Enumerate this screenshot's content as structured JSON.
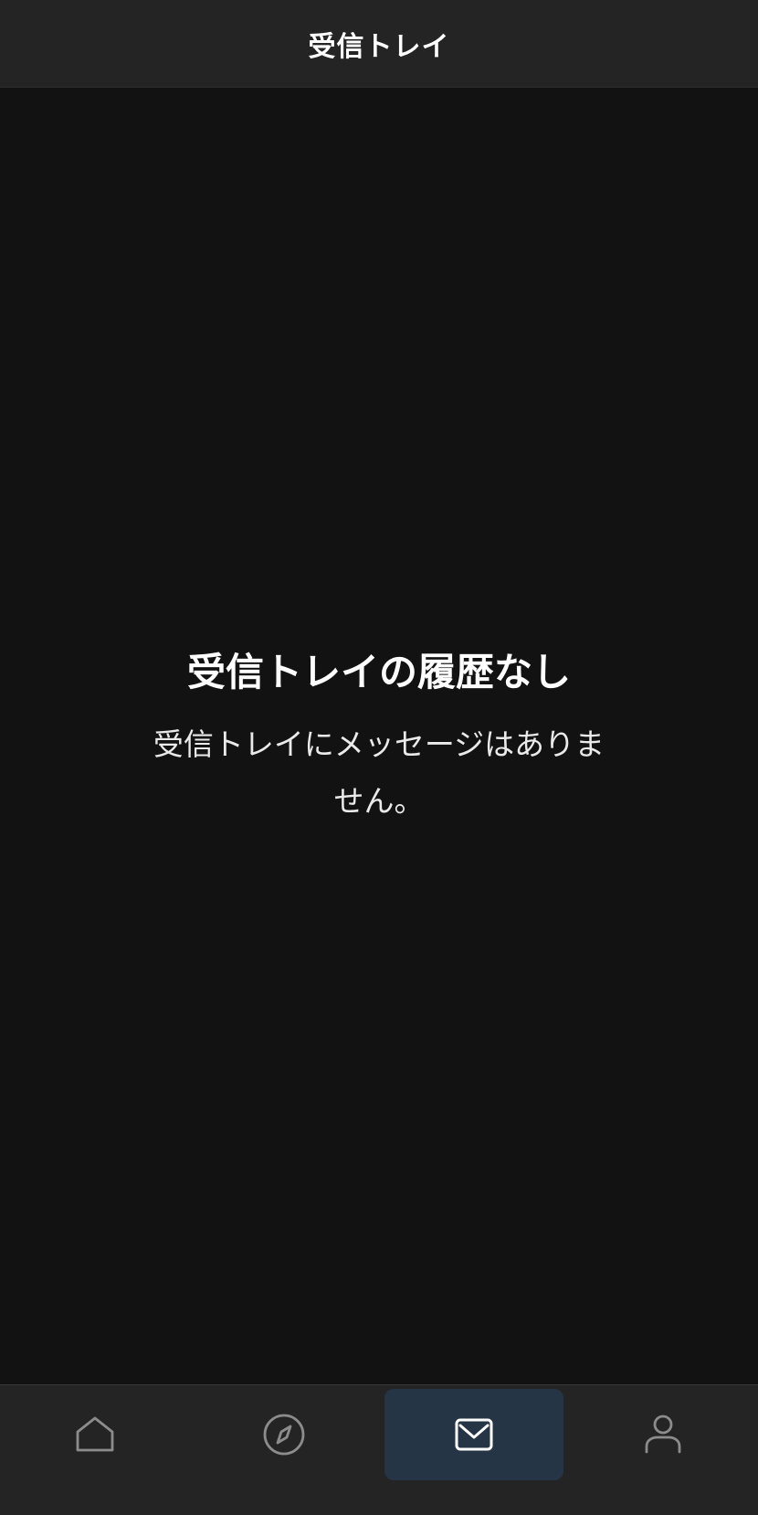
{
  "header": {
    "title": "受信トレイ"
  },
  "empty_state": {
    "title": "受信トレイの履歴なし",
    "description": "受信トレイにメッセージはありません。"
  },
  "tabbar": {
    "active_tab": "inbox",
    "items": [
      {
        "id": "home",
        "icon": "home-icon"
      },
      {
        "id": "discover",
        "icon": "compass-icon"
      },
      {
        "id": "inbox",
        "icon": "mail-icon"
      },
      {
        "id": "profile",
        "icon": "user-icon"
      }
    ]
  },
  "colors": {
    "background": "#121212",
    "bar": "#242424",
    "active_tab": "#263545",
    "icon_inactive": "#8c8c8c",
    "icon_active": "#ffffff"
  }
}
